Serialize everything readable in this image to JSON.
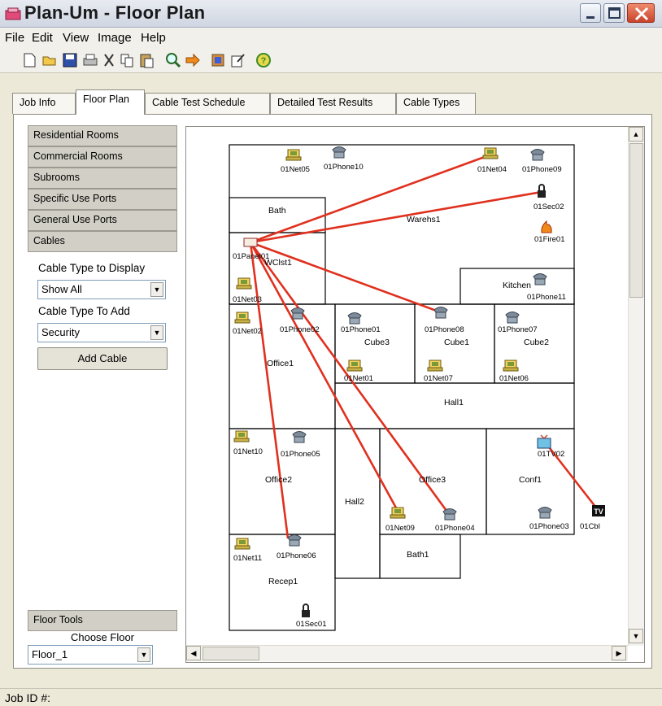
{
  "window": {
    "title": "Plan-Um  - Floor Plan"
  },
  "menu": [
    "File",
    "Edit",
    "View",
    "Image",
    "Help"
  ],
  "toolbar": {
    "icons": [
      "new-icon",
      "open-icon",
      "save-icon",
      "print-icon",
      "cut-icon",
      "copy-icon",
      "paste-icon",
      "zoom-icon",
      "forward-icon",
      "tool-icon",
      "edit-icon",
      "help-icon"
    ]
  },
  "tabs": [
    "Job Info",
    "Floor Plan",
    "Cable Test Schedule",
    "Detailed Test Results",
    "Cable Types"
  ],
  "sidebar": {
    "categories": [
      "Residential Rooms",
      "Commercial Rooms",
      "Subrooms",
      "Specific Use Ports",
      "General Use Ports",
      "Cables"
    ],
    "cable_type_display_label": "Cable Type to Display",
    "cable_type_display_value": "Show All",
    "cable_type_add_label": "Cable Type To Add",
    "cable_type_add_value": "Security",
    "add_cable_button": "Add Cable",
    "floor_tools": "Floor Tools",
    "choose_floor_label": "Choose Floor",
    "choose_floor_value": "Floor_1"
  },
  "floorplan": {
    "rooms": [
      "Warehs1",
      "Bath",
      "WClst1",
      "Kitchen",
      "Office1",
      "Cube3",
      "Cube1",
      "Cube2",
      "Hall1",
      "Office2",
      "Hall2",
      "Office3",
      "Conf1",
      "Recep1",
      "Bath1"
    ],
    "ports": [
      "01Net05",
      "01Phone10",
      "01Net04",
      "01Phone09",
      "01Sec02",
      "01Fire01",
      "01Panel01",
      "01Net03",
      "01Phone11",
      "01Net02",
      "01Phone02",
      "01Phone01",
      "01Phone08",
      "01Phone07",
      "01Net01",
      "01Net07",
      "01Net06",
      "01Net10",
      "01Phone05",
      "01TV02",
      "01Net09",
      "01Phone04",
      "01Phone03",
      "01Cbl",
      "01Net11",
      "01Phone06",
      "01Sec01"
    ]
  },
  "status": {
    "job_id_label": "Job ID #:"
  },
  "colors": {
    "cable": "#e0301e",
    "wall": "#000000",
    "tab_bg": "#ece9d8"
  }
}
